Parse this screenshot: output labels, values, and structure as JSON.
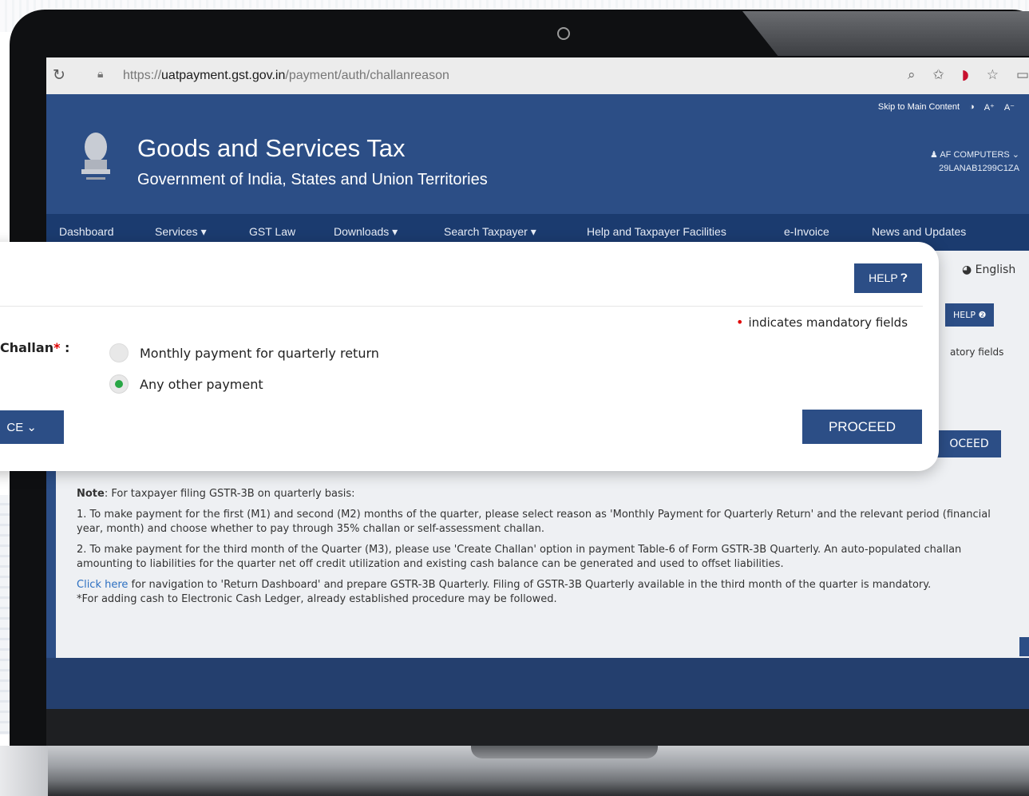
{
  "browser": {
    "url_prefix": "https://",
    "url_domain": "uatpayment.gst.gov.in",
    "url_path": "/payment/auth/challanreason",
    "reload_icon": "reload-icon",
    "lock_icon": "lock-icon"
  },
  "site": {
    "skip_link": "Skip to Main Content",
    "font_increase": "A⁺",
    "font_decrease": "A⁻",
    "title": "Goods and Services Tax",
    "subtitle": "Government of India, States and Union Territories",
    "user_name": "AF COMPUTERS ⌄",
    "user_gstin": "29LANAB1299C1ZA",
    "nav": [
      "Dashboard",
      "Services ▾",
      "GST Law",
      "Downloads ▾",
      "Search Taxpayer ▾",
      "Help and Taxpayer Facilities",
      "e-Invoice",
      "News and Updates"
    ],
    "language": "English",
    "help_small": "HELP ❷",
    "mandatory_partial": "atory fields",
    "proceed_partial": "OCEED"
  },
  "card": {
    "help_label": "HELP",
    "mandatory_text": "indicates mandatory fields",
    "challan_label": "Challan",
    "challan_suffix": " :",
    "options": [
      {
        "label": "Monthly payment for quarterly return",
        "selected": false
      },
      {
        "label": "Any other payment",
        "selected": true
      }
    ],
    "advance_label": "CE",
    "proceed_label": "PROCEED"
  },
  "notes": {
    "lead": "Note",
    "lead_text": ": For taxpayer filing GSTR-3B on quarterly basis:",
    "p1": "1. To make payment for the first (M1) and second (M2) months of the quarter, please select reason as 'Monthly Payment for Quarterly Return' and the relevant period (financial year, month) and choose whether to pay through 35% challan or self-assessment challan.",
    "p2": "2. To make payment for the third month of the Quarter (M3), please use 'Create Challan' option in payment Table-6 of Form GSTR-3B Quarterly. An auto-populated challan amounting to liabilities for the quarter net off credit utilization and existing cash balance can be generated and used to offset liabilities.",
    "link": "Click here",
    "p3": " for navigation to 'Return Dashboard' and prepare GSTR-3B Quarterly. Filing of GSTR-3B Quarterly available in the third month of the quarter is mandatory.",
    "p4": "*For adding cash to Electronic Cash Ledger, already established procedure may be followed."
  },
  "colors": {
    "brand_blue": "#2c4e86",
    "nav_blue": "#1b3b6f",
    "selected_green": "#28a745",
    "required_red": "#e00000"
  }
}
